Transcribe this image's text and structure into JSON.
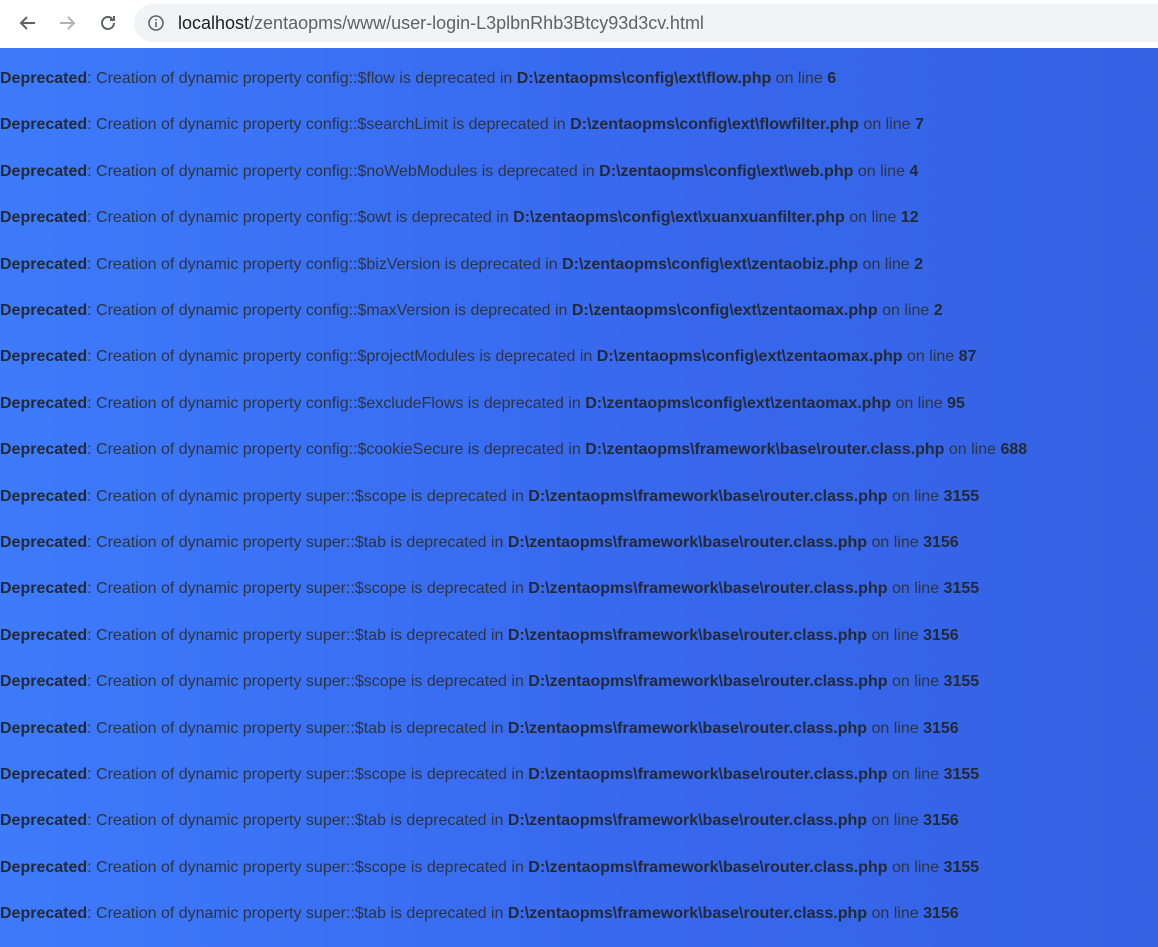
{
  "browser": {
    "url_host": "localhost",
    "url_path": "/zentaopms/www/user-login-L3plbnRhb3Btcy93d3cv.html",
    "icons": {
      "back": "arrow-left-icon",
      "forward": "arrow-right-icon",
      "reload": "reload-icon",
      "info": "info-icon"
    }
  },
  "colors": {
    "background_start": "#3d7bfb",
    "background_end": "#3362e3",
    "text": "#2c3442"
  },
  "messages": [
    {
      "label": "Deprecated",
      "text": ": Creation of dynamic property config::$flow is deprecated in ",
      "file": "D:\\zentaopms\\config\\ext\\flow.php",
      "on": " on line ",
      "line": "6"
    },
    {
      "label": "Deprecated",
      "text": ": Creation of dynamic property config::$searchLimit is deprecated in ",
      "file": "D:\\zentaopms\\config\\ext\\flowfilter.php",
      "on": " on line ",
      "line": "7"
    },
    {
      "label": "Deprecated",
      "text": ": Creation of dynamic property config::$noWebModules is deprecated in ",
      "file": "D:\\zentaopms\\config\\ext\\web.php",
      "on": " on line ",
      "line": "4"
    },
    {
      "label": "Deprecated",
      "text": ": Creation of dynamic property config::$owt is deprecated in ",
      "file": "D:\\zentaopms\\config\\ext\\xuanxuanfilter.php",
      "on": " on line ",
      "line": "12"
    },
    {
      "label": "Deprecated",
      "text": ": Creation of dynamic property config::$bizVersion is deprecated in ",
      "file": "D:\\zentaopms\\config\\ext\\zentaobiz.php",
      "on": " on line ",
      "line": "2"
    },
    {
      "label": "Deprecated",
      "text": ": Creation of dynamic property config::$maxVersion is deprecated in ",
      "file": "D:\\zentaopms\\config\\ext\\zentaomax.php",
      "on": " on line ",
      "line": "2"
    },
    {
      "label": "Deprecated",
      "text": ": Creation of dynamic property config::$projectModules is deprecated in ",
      "file": "D:\\zentaopms\\config\\ext\\zentaomax.php",
      "on": " on line ",
      "line": "87"
    },
    {
      "label": "Deprecated",
      "text": ": Creation of dynamic property config::$excludeFlows is deprecated in ",
      "file": "D:\\zentaopms\\config\\ext\\zentaomax.php",
      "on": " on line ",
      "line": "95"
    },
    {
      "label": "Deprecated",
      "text": ": Creation of dynamic property config::$cookieSecure is deprecated in ",
      "file": "D:\\zentaopms\\framework\\base\\router.class.php",
      "on": " on line ",
      "line": "688"
    },
    {
      "label": "Deprecated",
      "text": ": Creation of dynamic property super::$scope is deprecated in ",
      "file": "D:\\zentaopms\\framework\\base\\router.class.php",
      "on": " on line ",
      "line": "3155"
    },
    {
      "label": "Deprecated",
      "text": ": Creation of dynamic property super::$tab is deprecated in ",
      "file": "D:\\zentaopms\\framework\\base\\router.class.php",
      "on": " on line ",
      "line": "3156"
    },
    {
      "label": "Deprecated",
      "text": ": Creation of dynamic property super::$scope is deprecated in ",
      "file": "D:\\zentaopms\\framework\\base\\router.class.php",
      "on": " on line ",
      "line": "3155"
    },
    {
      "label": "Deprecated",
      "text": ": Creation of dynamic property super::$tab is deprecated in ",
      "file": "D:\\zentaopms\\framework\\base\\router.class.php",
      "on": " on line ",
      "line": "3156"
    },
    {
      "label": "Deprecated",
      "text": ": Creation of dynamic property super::$scope is deprecated in ",
      "file": "D:\\zentaopms\\framework\\base\\router.class.php",
      "on": " on line ",
      "line": "3155"
    },
    {
      "label": "Deprecated",
      "text": ": Creation of dynamic property super::$tab is deprecated in ",
      "file": "D:\\zentaopms\\framework\\base\\router.class.php",
      "on": " on line ",
      "line": "3156"
    },
    {
      "label": "Deprecated",
      "text": ": Creation of dynamic property super::$scope is deprecated in ",
      "file": "D:\\zentaopms\\framework\\base\\router.class.php",
      "on": " on line ",
      "line": "3155"
    },
    {
      "label": "Deprecated",
      "text": ": Creation of dynamic property super::$tab is deprecated in ",
      "file": "D:\\zentaopms\\framework\\base\\router.class.php",
      "on": " on line ",
      "line": "3156"
    },
    {
      "label": "Deprecated",
      "text": ": Creation of dynamic property super::$scope is deprecated in ",
      "file": "D:\\zentaopms\\framework\\base\\router.class.php",
      "on": " on line ",
      "line": "3155"
    },
    {
      "label": "Deprecated",
      "text": ": Creation of dynamic property super::$tab is deprecated in ",
      "file": "D:\\zentaopms\\framework\\base\\router.class.php",
      "on": " on line ",
      "line": "3156"
    }
  ]
}
